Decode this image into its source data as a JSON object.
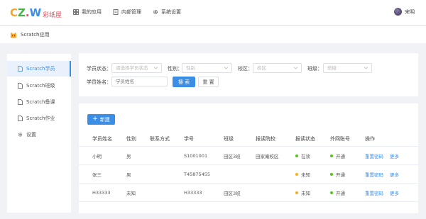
{
  "app": {
    "logo_text": "彩纸屋",
    "user_name": "宋明"
  },
  "topnav": [
    {
      "label": "我的应用",
      "icon": "grid-icon"
    },
    {
      "label": "内部管理",
      "icon": "document-icon"
    },
    {
      "label": "系统设置",
      "icon": "gear-icon"
    }
  ],
  "breadcrumb": {
    "label": "Scratch应用",
    "icon": "cat-icon"
  },
  "sidebar": {
    "items": [
      {
        "label": "Scratch学员",
        "icon": "file-icon",
        "active": true
      },
      {
        "label": "Scratch班级",
        "icon": "file-icon",
        "active": false
      },
      {
        "label": "Scratch备课",
        "icon": "file-icon",
        "active": false
      },
      {
        "label": "Scratch作业",
        "icon": "file-icon",
        "active": false
      },
      {
        "label": "设置",
        "icon": "gear-icon",
        "active": false
      }
    ]
  },
  "filters": {
    "status": {
      "label": "学员状态：",
      "placeholder": "请选择学员状态"
    },
    "gender": {
      "label": "性别：",
      "placeholder": "性别"
    },
    "campus": {
      "label": "校区：",
      "placeholder": "校区"
    },
    "class": {
      "label": "班级：",
      "placeholder": "班级"
    },
    "name": {
      "label": "学员姓名：",
      "placeholder": "学员姓名"
    },
    "search_label": "搜 索",
    "reset_label": "重 置"
  },
  "table": {
    "new_label": "新建",
    "columns": [
      "学员姓名",
      "性别",
      "联系方式",
      "学号",
      "班级",
      "报读院校",
      "报读状态",
      "外网账号",
      "操作"
    ],
    "rows": [
      {
        "name": "小明",
        "gender": "男",
        "contact": "",
        "student_id": "S1001001",
        "class": "田区3班",
        "school": "田家庵校区",
        "status": "在读",
        "status_color": "#52c41a",
        "account": "开通",
        "account_color": "#52c41a",
        "actions": [
          "重置密码",
          "更多"
        ]
      },
      {
        "name": "张三",
        "gender": "男",
        "contact": "",
        "student_id": "T45875455",
        "class": "",
        "school": "",
        "status": "未知",
        "status_color": "#faad14",
        "account": "开通",
        "account_color": "#52c41a",
        "actions": [
          "重置密码",
          "更多"
        ]
      },
      {
        "name": "H33333",
        "gender": "未知",
        "contact": "",
        "student_id": "H33333",
        "class": "田区3班",
        "school": "",
        "status": "未知",
        "status_color": "#faad14",
        "account": "开通",
        "account_color": "#52c41a",
        "actions": [
          "重置密码",
          "更多"
        ]
      }
    ]
  },
  "colors": {
    "primary": "#3a8ee6",
    "success": "#52c41a",
    "warning": "#faad14"
  }
}
